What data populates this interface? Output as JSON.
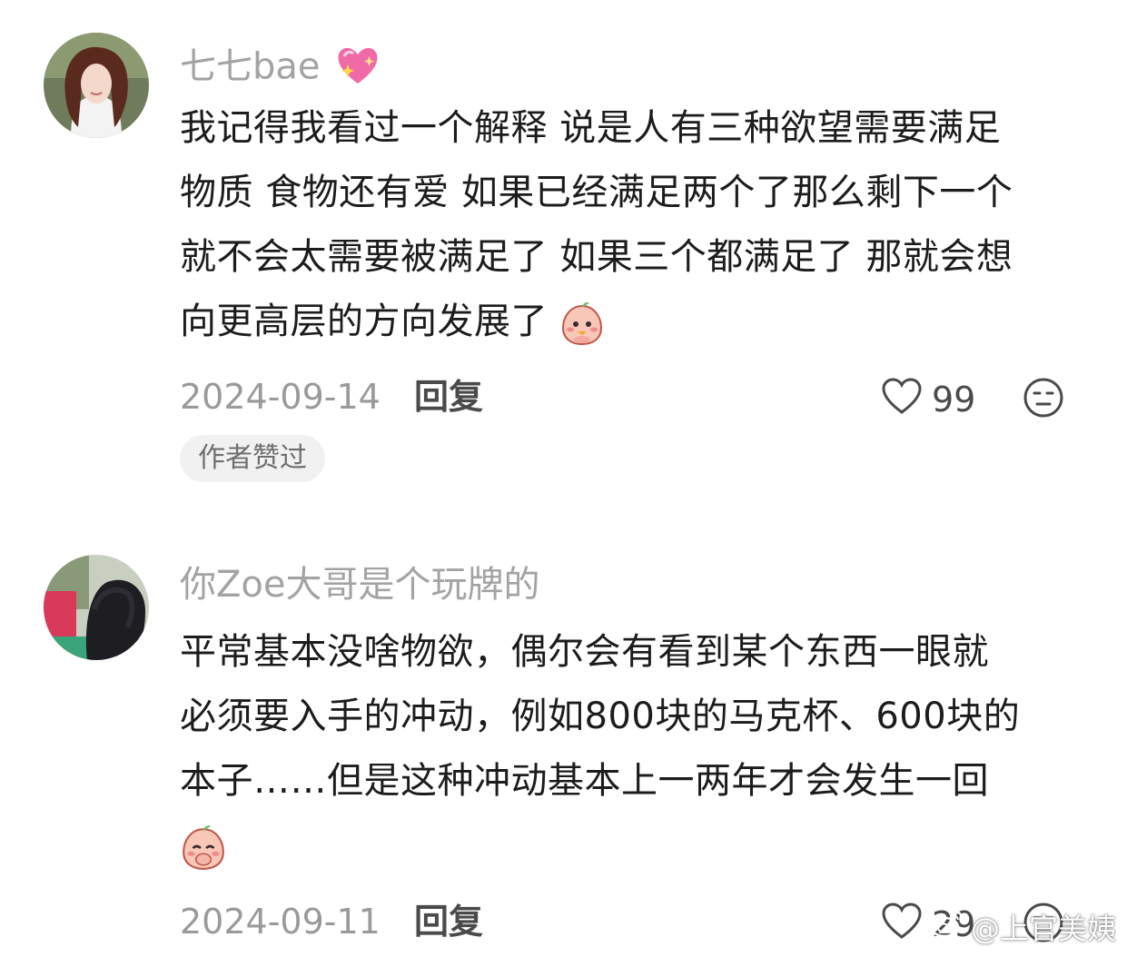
{
  "comments": [
    {
      "username": "七七bae",
      "username_emoji": "sparkling-heart-icon",
      "text_lines": [
        "我记得我看过一个解释 说是人有三种欲望需要满足",
        "物质 食物还有爱 如果已经满足两个了那么剩下一个",
        "就不会太需要被满足了 如果三个都满足了 那就会想",
        "向更高层的方向发展了"
      ],
      "date": "2024-09-14",
      "reply_label": "回复",
      "likes": "99",
      "badge": "作者赞过"
    },
    {
      "username": "你Zoe大哥是个玩牌的",
      "text_lines": [
        "平常基本没啥物欲，偶尔会有看到某个东西一眼就",
        "必须要入手的冲动，例如800块的马克杯、600块的",
        "本子……但是这种冲动基本上一两年才会发生一回"
      ],
      "date": "2024-09-11",
      "reply_label": "回复",
      "likes": "29"
    }
  ],
  "watermark": "@上官美姨",
  "colors": {
    "username": "#a3a3a3",
    "text": "#1c1c1c",
    "meta": "#9a9a9a",
    "badge_bg": "#f1f1f1"
  }
}
